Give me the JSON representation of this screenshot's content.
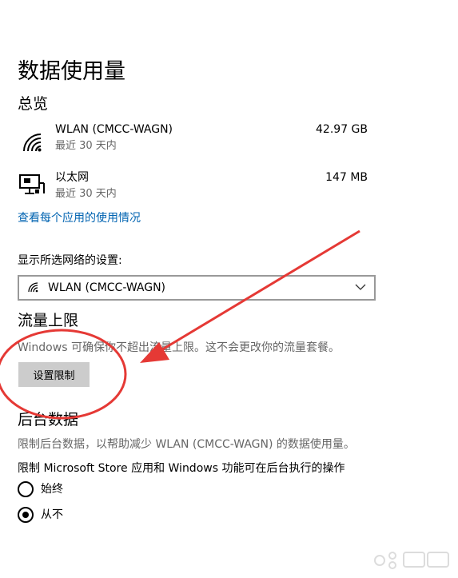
{
  "page": {
    "title": "数据使用量"
  },
  "overview": {
    "title": "总览",
    "items": [
      {
        "icon": "wifi-icon",
        "name": "WLAN (CMCC-WAGN)",
        "period": "最近 30 天内",
        "usage": "42.97 GB"
      },
      {
        "icon": "ethernet-icon",
        "name": "以太网",
        "period": "最近 30 天内",
        "usage": "147 MB"
      }
    ],
    "per_app_link": "查看每个应用的使用情况"
  },
  "network_select": {
    "label": "显示所选网络的设置:",
    "selected": "WLAN (CMCC-WAGN)"
  },
  "data_limit": {
    "title": "流量上限",
    "description": "Windows 可确保你不超出流量上限。这不会更改你的流量套餐。",
    "button": "设置限制"
  },
  "background_data": {
    "title": "后台数据",
    "description": "限制后台数据，以帮助减少 WLAN (CMCC-WAGN) 的数据使用量。",
    "question": "限制 Microsoft Store 应用和 Windows 功能可在后台执行的操作",
    "options": [
      {
        "label": "始终",
        "selected": false
      },
      {
        "label": "从不",
        "selected": true
      }
    ]
  },
  "annotation": {
    "color": "#e53935"
  }
}
